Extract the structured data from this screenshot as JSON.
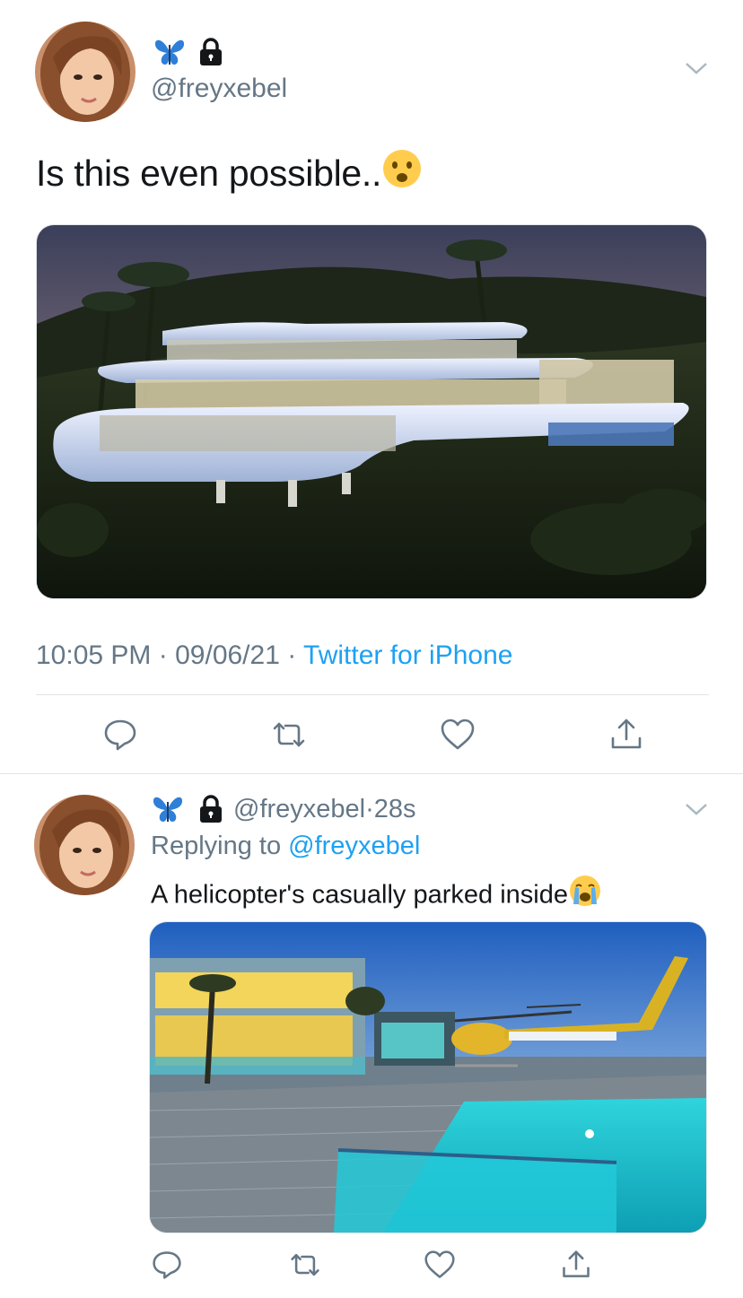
{
  "main_tweet": {
    "handle": "@freyxebel",
    "text": "Is this even possible..",
    "emoji": "frowning-face-with-open-mouth",
    "time": "10:05 PM",
    "date": "09/06/21",
    "separator": "·",
    "source": "Twitter for iPhone",
    "image_subject": "modern hillside mansion at dusk"
  },
  "reply_tweet": {
    "handle": "@freyxebel",
    "separator": "·",
    "age": "28s",
    "replying_prefix": "Replying to",
    "replying_handle": "@freyxebel",
    "text": "A helicopter's casually parked inside",
    "emoji": "loudly-crying-face",
    "image_subject": "pool deck with parked helicopter"
  },
  "icons": {
    "name_emoji": "butterfly-icon",
    "protected": "lock-icon",
    "menu": "chevron-down-icon",
    "reply": "comment-icon",
    "retweet": "retweet-icon",
    "like": "heart-icon",
    "share": "share-icon"
  },
  "colors": {
    "accent": "#1da1f2",
    "secondary_text": "#657786",
    "primary_text": "#14171a",
    "divider": "#dfe4e8"
  }
}
